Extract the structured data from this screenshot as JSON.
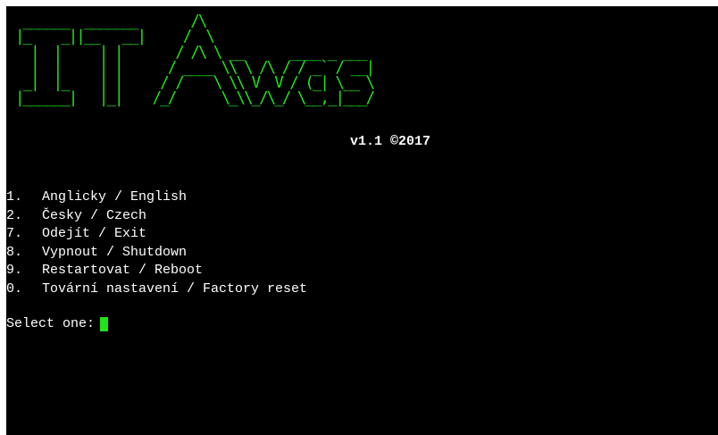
{
  "banner": {
    "ascii_lines": [
      " ______  _______       /\\",
      "|_    _||__   __|     /  \\",
      "  |  |     | |       / /\\ \\ __      ____ _ ___",
      "  |  |     | |      / ____ \\\\ \\ /\\ / / _` / __|",
      " _|  |_    | |     / /    \\ \\\\ V  V / (_| \\__ \\",
      "|______|   |_|    /_/      \\_\\\\_/\\_/ \\__,_|___/"
    ],
    "version": "v1.1 ©2017"
  },
  "menu": {
    "items": [
      {
        "key": "1.",
        "label": "Anglicky / English"
      },
      {
        "key": "2.",
        "label": "Česky / Czech"
      },
      {
        "key": "7.",
        "label": "Odejít / Exit"
      },
      {
        "key": "8.",
        "label": "Vypnout / Shutdown"
      },
      {
        "key": "9.",
        "label": "Restartovat / Reboot"
      },
      {
        "key": "0.",
        "label": "Tovární nastavení / Factory reset"
      }
    ]
  },
  "prompt": {
    "text": "Select one:"
  },
  "colors": {
    "background": "#000000",
    "banner": "#22e31c",
    "text": "#ffffff",
    "cursor": "#22e31c"
  }
}
